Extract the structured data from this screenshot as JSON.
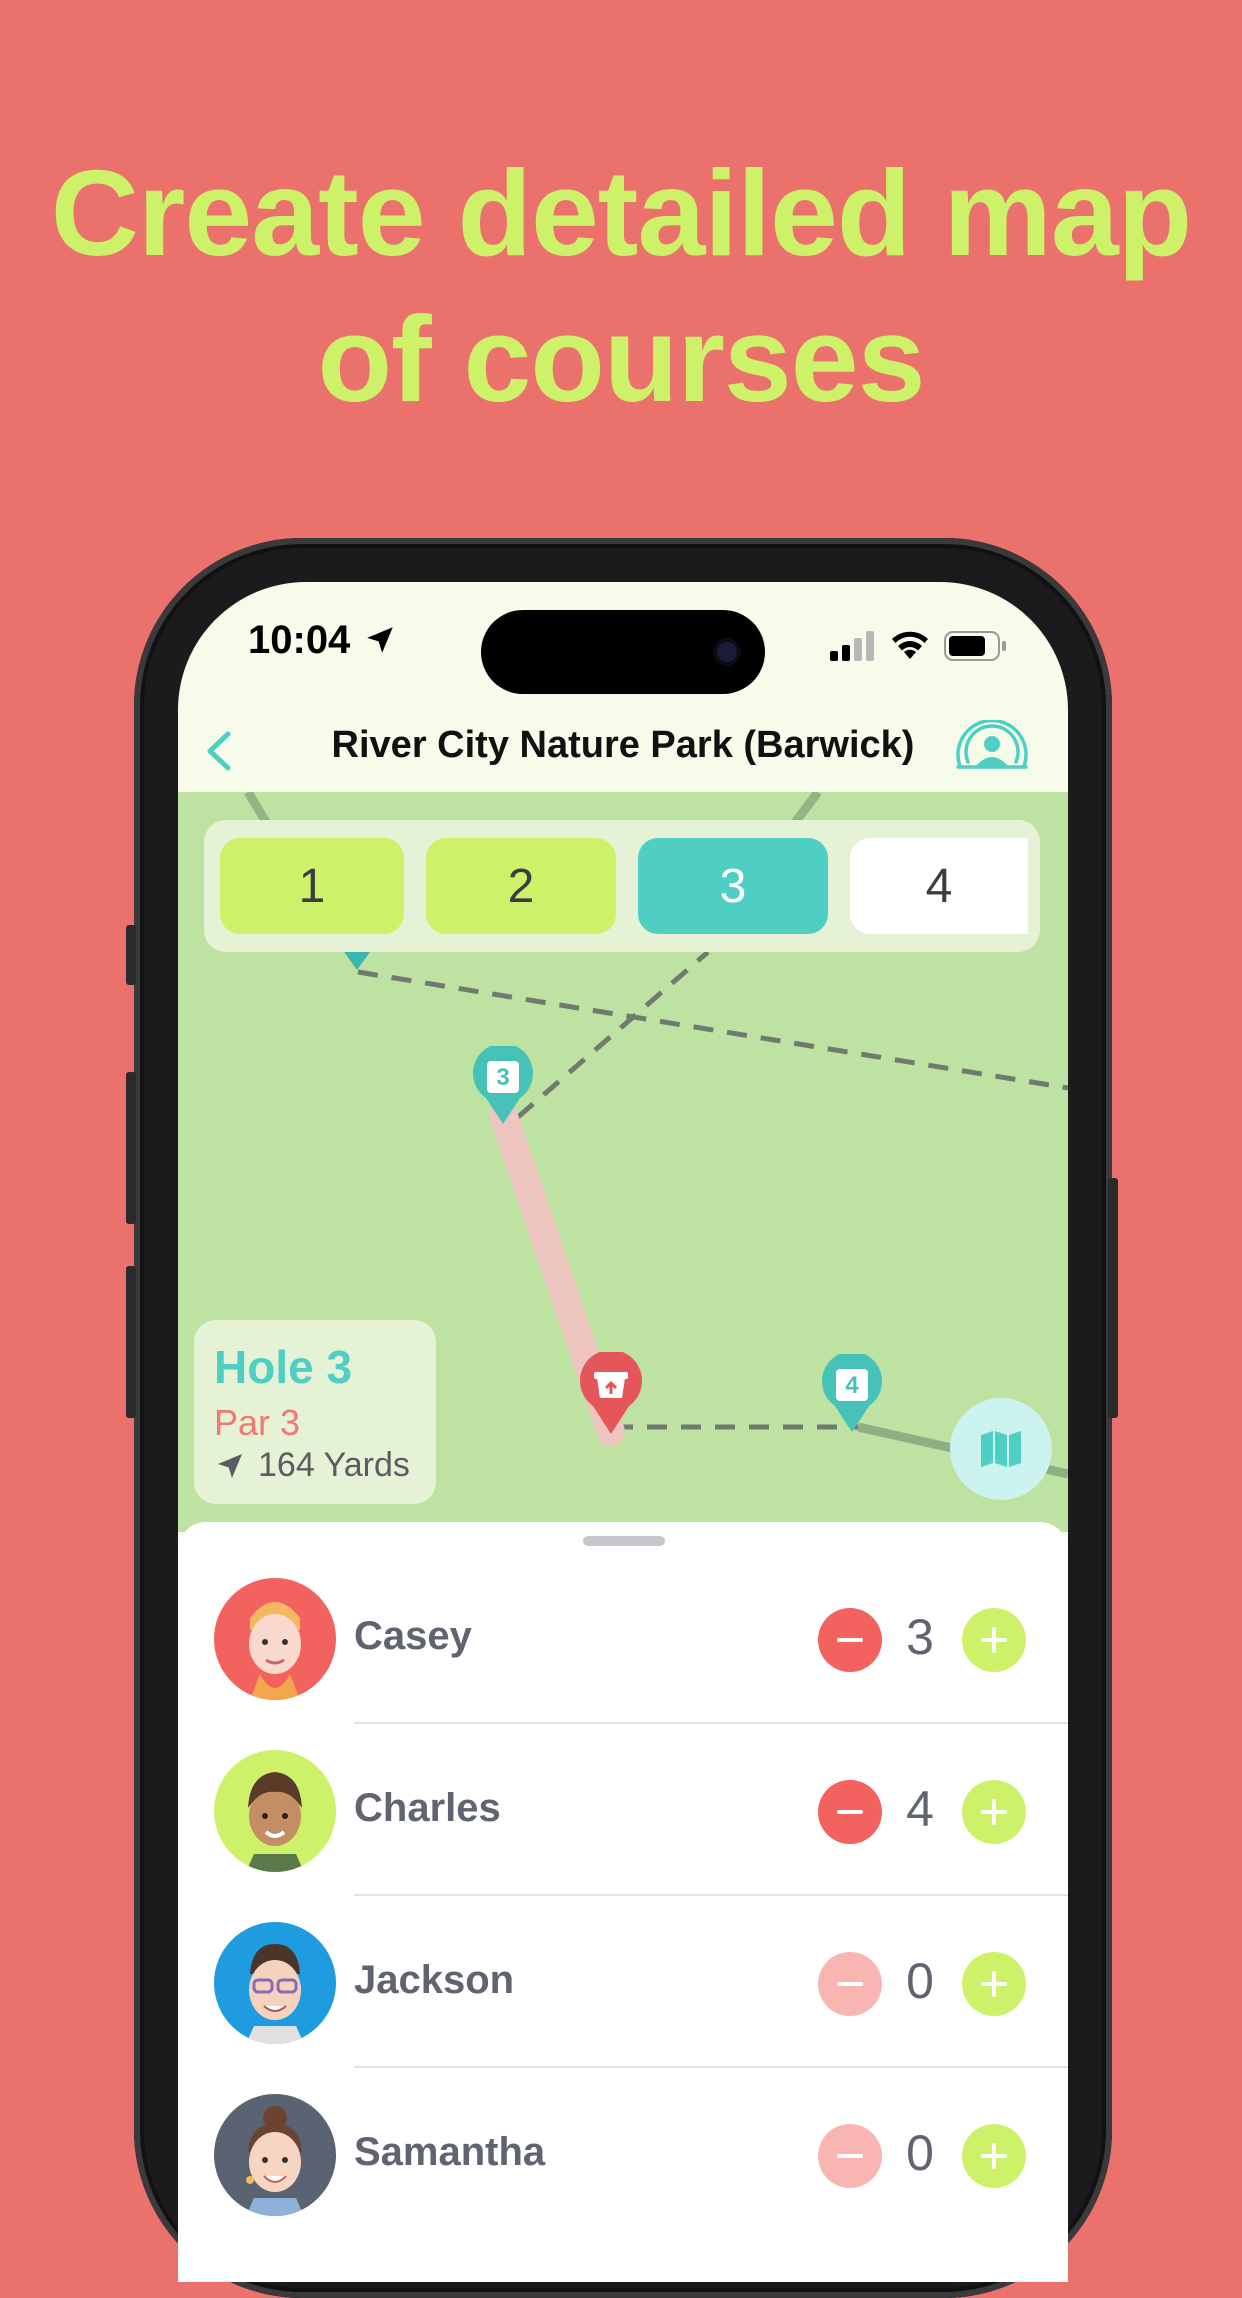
{
  "headline": {
    "line1": "Create detailed map",
    "line2": "of courses"
  },
  "colors": {
    "background": "#EB716D",
    "accent_lime": "#CDF26A",
    "accent_teal": "#4FCFC4",
    "accent_red": "#F2625F"
  },
  "status_bar": {
    "time": "10:04"
  },
  "nav": {
    "title": "River City Nature Park (Barwick)"
  },
  "holes": [
    {
      "label": "1",
      "state": "completed"
    },
    {
      "label": "2",
      "state": "completed"
    },
    {
      "label": "3",
      "state": "selected"
    },
    {
      "label": "4",
      "state": "upcoming"
    }
  ],
  "hole_info": {
    "title": "Hole 3",
    "par": "Par 3",
    "yards": "164 Yards"
  },
  "map_markers": {
    "marker_3": "3",
    "marker_4": "4"
  },
  "players": [
    {
      "name": "Casey",
      "score": "3",
      "avatar_color": "#F2625F",
      "minus_enabled": true
    },
    {
      "name": "Charles",
      "score": "4",
      "avatar_color": "#CDF26A",
      "minus_enabled": true
    },
    {
      "name": "Jackson",
      "score": "0",
      "avatar_color": "#1F9BE0",
      "minus_enabled": false
    },
    {
      "name": "Samantha",
      "score": "0",
      "avatar_color": "#5A6372",
      "minus_enabled": false
    }
  ]
}
